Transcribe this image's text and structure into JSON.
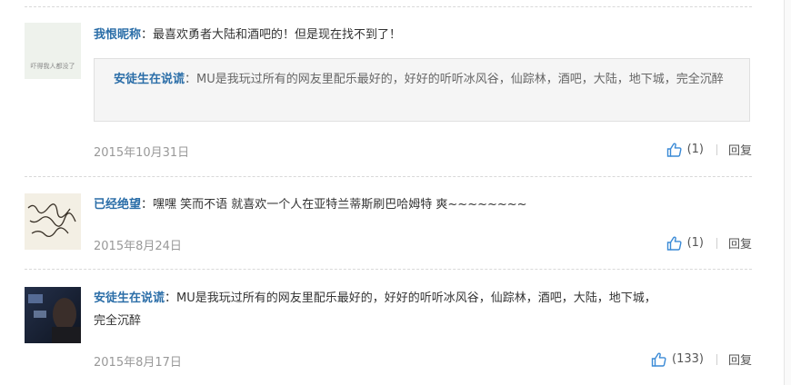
{
  "comments": [
    {
      "author": "我恨昵称",
      "text": "：最喜欢勇者大陆和酒吧的！但是现在找不到了！",
      "avatar_caption": "吓得我人都没了",
      "quote": {
        "author": "安徒生在说谎",
        "text": "：MU是我玩过所有的网友里配乐最好的，好好的听听冰风谷，仙踪林，酒吧，大陆，地下城，完全沉醉"
      },
      "date": "2015年10月31日",
      "likes": "(1)",
      "reply": "回复"
    },
    {
      "author": "已经绝望",
      "text": "：嘿嘿 笑而不语 就喜欢一个人在亚特兰蒂斯刷巴哈姆特 爽~~~~~~~~",
      "date": "2015年8月24日",
      "likes": "(1)",
      "reply": "回复"
    },
    {
      "author": "安徒生在说谎",
      "text_line1": "：MU是我玩过所有的网友里配乐最好的，好好的听听冰风谷，仙踪林，酒吧，大陆，地下城，",
      "text_line2": "完全沉醉",
      "date": "2015年8月17日",
      "likes": "(133)",
      "reply": "回复"
    }
  ],
  "colors": {
    "link": "#2b6ea8",
    "meta": "#999999",
    "quote_bg": "#f5f5f5",
    "like_icon": "#3a8ad6"
  }
}
